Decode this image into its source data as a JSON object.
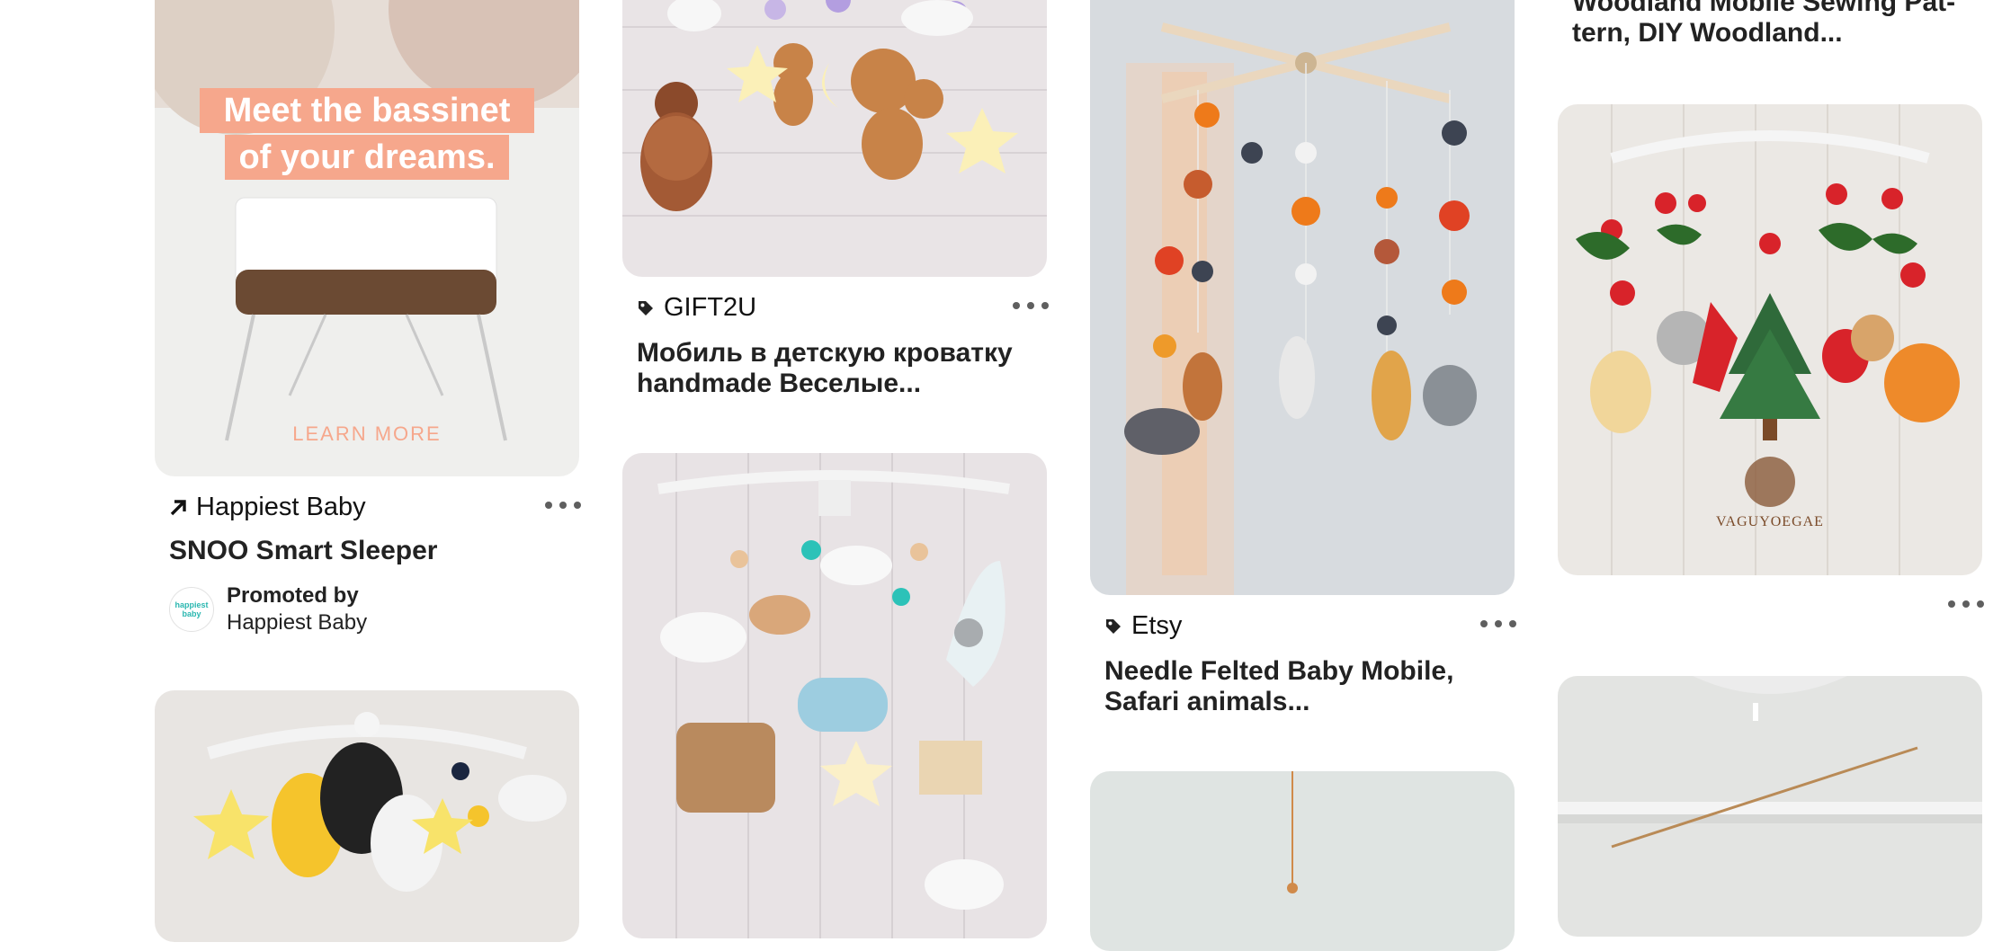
{
  "columns": [
    {
      "pins": [
        {
          "image_text": {
            "line1": "Meet the bassinet",
            "line2": "of your dreams.",
            "cta": "LEARN MORE"
          },
          "source": "Happiest Baby",
          "source_icon": "arrow-up-right-icon",
          "title": "SNOO Smart Sleeper",
          "promoted_label": "Promoted by",
          "promoted_by": "Happiest Baby",
          "avatar_text": "happiest baby"
        },
        {
          "image": "felt-balloons-mobile-image"
        }
      ]
    },
    {
      "pins": [
        {
          "image": "felt-bears-mobile-image",
          "source": "GIFT2U",
          "source_icon": "tag-icon",
          "title_line1": "Мобиль в детскую кроватку",
          "title_line2": "handmade Веселые..."
        },
        {
          "image": "felt-transport-mobile-image"
        }
      ]
    },
    {
      "pins": [
        {
          "image": "safari-animals-mobile-image",
          "source": "Etsy",
          "source_icon": "tag-icon",
          "title_line1": "Needle Felted Baby Mobile,",
          "title_line2": "Safari animals..."
        },
        {
          "image": "wooden-mobile-image"
        }
      ]
    },
    {
      "pins": [
        {
          "title_line1": "Woodland Mobile Sewing Pat-",
          "title_line2": "tern, DIY Woodland..."
        },
        {
          "image": "woodland-animals-mobile-image",
          "image_text": "VAGUYOEGAE"
        },
        {
          "image": "ceiling-mobile-image"
        }
      ]
    }
  ],
  "colors": {
    "more_dots": "#5f5f5f",
    "title": "#222222",
    "promo_orange": "#f6a78c"
  }
}
